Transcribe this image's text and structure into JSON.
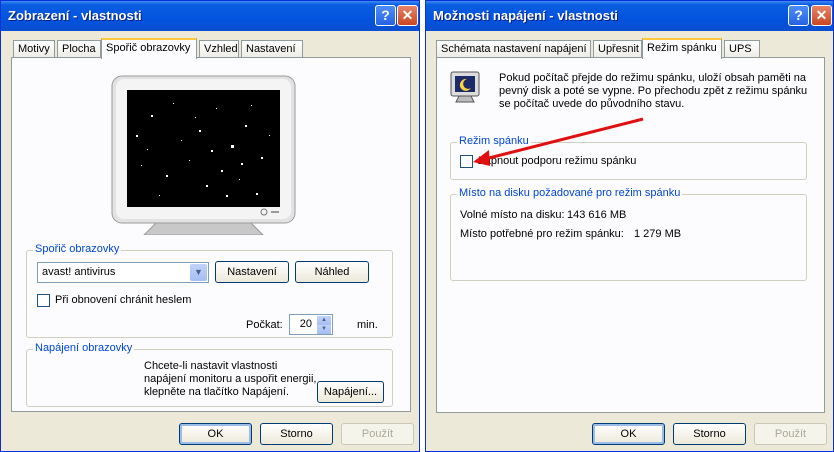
{
  "display_window": {
    "title": "Zobrazení - vlastnosti",
    "tabs": [
      "Motivy",
      "Plocha",
      "Spořič obrazovky",
      "Vzhled",
      "Nastavení"
    ],
    "screensaver_group": {
      "label": "Spořič obrazovky",
      "selected": "avast! antivirus",
      "settings_button": "Nastavení",
      "preview_button": "Náhled",
      "password_checkbox_label": "Při obnovení chránit heslem",
      "wait_label": "Počkat:",
      "wait_value": "20",
      "wait_unit": "min."
    },
    "power_group": {
      "label": "Napájení obrazovky",
      "text_lines": [
        "Chcete-li nastavit vlastnosti",
        "napájení monitoru a uspořit energii,",
        "klepněte na tlačítko Napájení."
      ],
      "button": "Napájení..."
    },
    "buttons": {
      "ok": "OK",
      "cancel": "Storno",
      "apply": "Použít"
    }
  },
  "power_window": {
    "title": "Možnosti napájení - vlastnosti",
    "tabs": [
      "Schémata nastavení napájení",
      "Upřesnit",
      "Režim spánku",
      "UPS"
    ],
    "info_lines": [
      "Pokud počítač přejde do režimu spánku, uloží obsah paměti na",
      "pevný disk a poté se vypne. Po přechodu zpět z režimu spánku",
      "se počítač uvede do původního stavu."
    ],
    "hibernate_group": {
      "label": "Režim spánku",
      "checkbox_label": "Zapnout podporu režimu spánku",
      "checked": false
    },
    "disk_group": {
      "label": "Místo na disku požadované pro režim spánku",
      "free_label": "Volné místo na disku:",
      "free_value": "143 616 MB",
      "required_label": "Místo potřebné pro režim spánku:",
      "required_value": "1 279 MB"
    },
    "buttons": {
      "ok": "OK",
      "cancel": "Storno",
      "apply": "Použít"
    }
  },
  "colors": {
    "titlebar": "#0353df",
    "dialog_bg": "#ece9d8",
    "group_label": "#0046d5",
    "annotation_arrow": "#e01010"
  },
  "icons": [
    "help-icon",
    "close-icon",
    "monitor-preview-icon",
    "hibernate-monitor-icon",
    "dropdown-arrow-icon",
    "spin-up-icon",
    "spin-down-icon",
    "red-arrow-annotation"
  ]
}
